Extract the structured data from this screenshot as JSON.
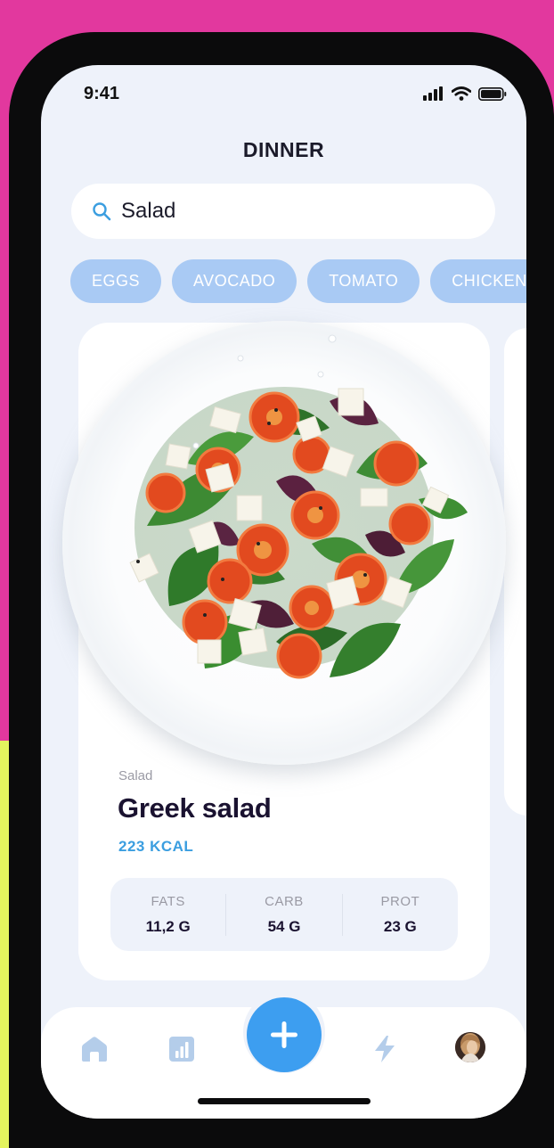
{
  "status_bar": {
    "time": "9:41"
  },
  "header": {
    "title": "DINNER"
  },
  "search": {
    "value": "Salad",
    "placeholder": ""
  },
  "chips": [
    "EGGS",
    "AVOCADO",
    "TOMATO",
    "CHICKEN"
  ],
  "card": {
    "category": "Salad",
    "name": "Greek salad",
    "kcal": "223 KCAL",
    "macros": [
      {
        "label": "FATS",
        "value": "11,2 G"
      },
      {
        "label": "CARB",
        "value": "54 G"
      },
      {
        "label": "PROT",
        "value": "23 G"
      }
    ]
  },
  "tabbar": {
    "items": [
      "home-icon",
      "stats-icon",
      "add-icon",
      "bolt-icon",
      "avatar"
    ]
  },
  "colors": {
    "accent": "#3d9ef0",
    "chip": "#a9caf4",
    "kcal": "#3b9ee0",
    "background_top": "#e2389e",
    "background_bottom": "#e4f45e"
  }
}
